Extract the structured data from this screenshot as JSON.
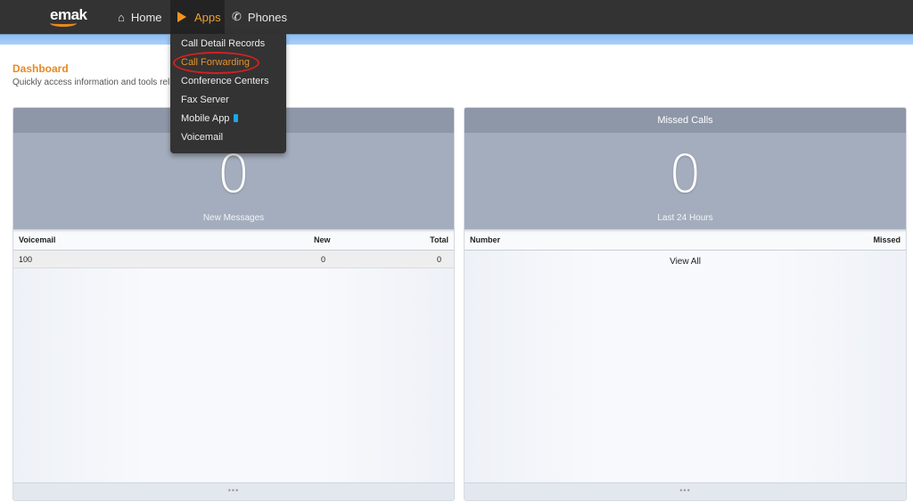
{
  "nav": {
    "logo": "emak",
    "items": [
      {
        "label": "Home",
        "icon": "home-icon"
      },
      {
        "label": "Apps",
        "icon": "play-icon",
        "active": true
      },
      {
        "label": "Phones",
        "icon": "phone-icon"
      }
    ]
  },
  "apps_menu": {
    "items": [
      {
        "label": "Call Detail Records"
      },
      {
        "label": "Call Forwarding",
        "highlighted": true
      },
      {
        "label": "Conference Centers"
      },
      {
        "label": "Fax Server"
      },
      {
        "label": "Mobile App",
        "icon": "mobile-phone-icon"
      },
      {
        "label": "Voicemail"
      }
    ]
  },
  "page": {
    "title": "Dashboard",
    "subtitle": "Quickly access information and tools rel"
  },
  "voicemail_panel": {
    "title": "",
    "count": "0",
    "count_label": "New Messages",
    "columns": [
      "Voicemail",
      "New",
      "Total"
    ],
    "rows": [
      {
        "voicemail": "100",
        "new": "0",
        "total": "0"
      }
    ],
    "footer": "•••"
  },
  "missed_panel": {
    "title": "Missed Calls",
    "count": "0",
    "count_label": "Last 24 Hours",
    "columns": [
      "Number",
      "Missed"
    ],
    "view_all": "View All",
    "footer": "•••"
  },
  "colors": {
    "accent": "#e8891f",
    "topbar": "#333333",
    "band": "#a8d0fb",
    "panel_header": "#8e97a8",
    "panel_stat": "#a4adbd",
    "highlight_ring": "#d42020"
  }
}
